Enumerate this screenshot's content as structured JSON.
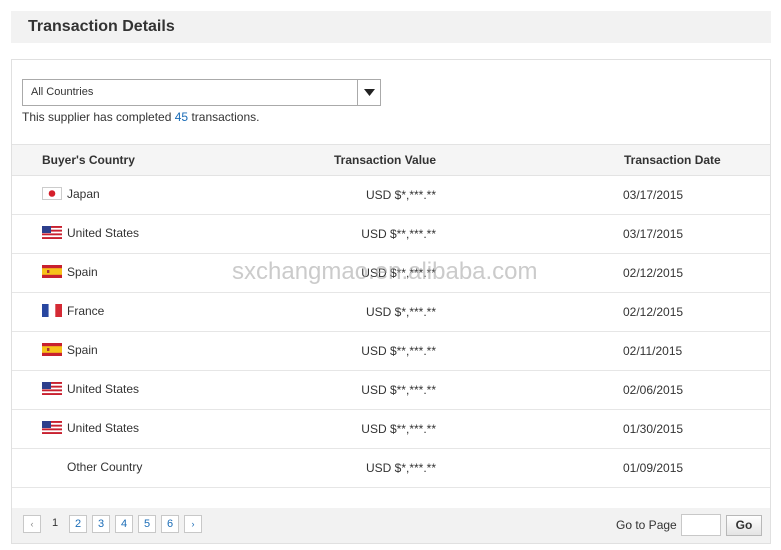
{
  "header": {
    "title": "Transaction Details"
  },
  "filter": {
    "selected": "All Countries",
    "summary_prefix": "This supplier has completed ",
    "summary_count": "45",
    "summary_suffix": " transactions."
  },
  "table": {
    "columns": [
      "Buyer's Country",
      "Transaction Value",
      "Transaction Date"
    ],
    "rows": [
      {
        "country": "Japan",
        "flag": "japan-flag-icon",
        "value": "USD $*,***.**",
        "date": "03/17/2015"
      },
      {
        "country": "United States",
        "flag": "us-flag-icon",
        "value": "USD $**,***.**",
        "date": "03/17/2015"
      },
      {
        "country": "Spain",
        "flag": "spain-flag-icon",
        "value": "USD $**,***.**",
        "date": "02/12/2015"
      },
      {
        "country": "France",
        "flag": "france-flag-icon",
        "value": "USD $*,***.**",
        "date": "02/12/2015"
      },
      {
        "country": "Spain",
        "flag": "spain-flag-icon",
        "value": "USD $**,***.**",
        "date": "02/11/2015"
      },
      {
        "country": "United States",
        "flag": "us-flag-icon",
        "value": "USD $**,***.**",
        "date": "02/06/2015"
      },
      {
        "country": "United States",
        "flag": "us-flag-icon",
        "value": "USD $**,***.**",
        "date": "01/30/2015"
      },
      {
        "country": "Other Country",
        "flag": "",
        "value": "USD $*,***.**",
        "date": "01/09/2015"
      }
    ]
  },
  "pagination": {
    "prev_icon": "‹",
    "next_icon": "›",
    "pages": [
      "1",
      "2",
      "3",
      "4",
      "5",
      "6"
    ],
    "current": "1",
    "goto_label": "Go to Page",
    "go_button": "Go"
  },
  "watermark": "sxchangmao.en.alibaba.com",
  "colors": {
    "link": "#1a6cb7",
    "header_bg": "#f2f2f2"
  }
}
